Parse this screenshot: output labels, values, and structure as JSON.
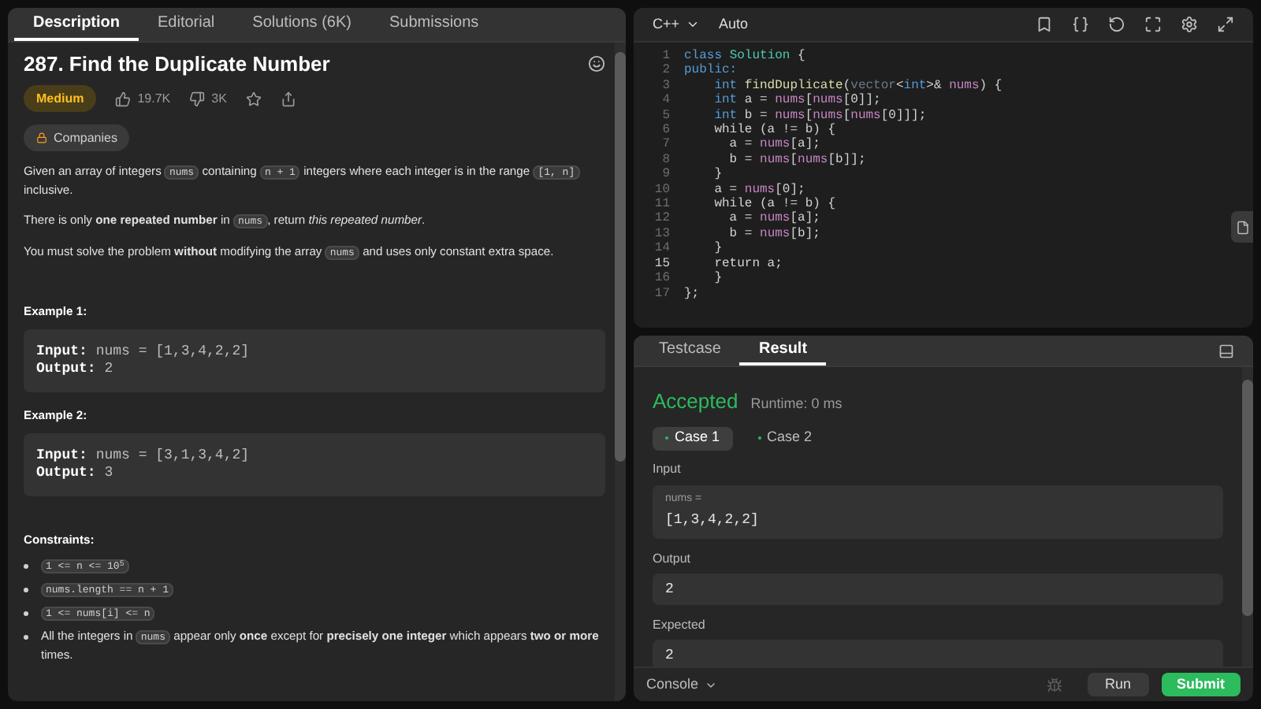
{
  "left_tabs": [
    {
      "label": "Description",
      "selected": true
    },
    {
      "label": "Editorial",
      "selected": false
    },
    {
      "label": "Solutions (6K)",
      "selected": false
    },
    {
      "label": "Submissions",
      "selected": false
    }
  ],
  "problem": {
    "title": "287. Find the Duplicate Number",
    "difficulty": "Medium",
    "likes": "19.7K",
    "dislikes": "3K",
    "companies": "Companies",
    "paragraphs": [
      [
        {
          "kind": "text",
          "text": "Given an array of integers "
        },
        {
          "kind": "code",
          "text": "nums"
        },
        {
          "kind": "text",
          "text": " containing "
        },
        {
          "kind": "code",
          "text": "n + 1"
        },
        {
          "kind": "text",
          "text": " integers where each integer is in the range "
        },
        {
          "kind": "code",
          "text": "[1, n]"
        },
        {
          "kind": "text",
          "text": " inclusive."
        }
      ],
      [
        {
          "kind": "text",
          "text": "There is only **one repeated number** in "
        },
        {
          "kind": "code",
          "text": "nums"
        },
        {
          "kind": "text",
          "text": ", return *this repeated number*."
        }
      ],
      [
        {
          "kind": "text",
          "text": "You must solve the problem **without** modifying the array "
        },
        {
          "kind": "code",
          "text": "nums"
        },
        {
          "kind": "text",
          "text": " and uses only constant extra space."
        }
      ]
    ],
    "examples": [
      {
        "title": "Example 1:",
        "input_label": "Input:",
        "input": "nums = [1,3,4,2,2]",
        "output_label": "Output:",
        "output": "2"
      },
      {
        "title": "Example 2:",
        "input_label": "Input:",
        "input": "nums = [3,1,3,4,2]",
        "output_label": "Output:",
        "output": "3"
      }
    ],
    "constraints_title": "Constraints:",
    "constraints": [
      [
        {
          "kind": "code",
          "text": "1 <= n <= 10$^{5}$"
        }
      ],
      [
        {
          "kind": "code",
          "text": "nums.length == n + 1"
        }
      ],
      [
        {
          "kind": "code",
          "text": "1 <= nums[i] <= n"
        }
      ],
      [
        {
          "kind": "text",
          "text": "All the integers in "
        },
        {
          "kind": "code",
          "text": "nums"
        },
        {
          "kind": "text",
          "text": " appear only **once** except for **precisely one integer** which appears **two or more** times."
        }
      ]
    ]
  },
  "editor": {
    "language": "C++",
    "mode": "Auto",
    "lines": [
      {
        "number": "1",
        "active": false,
        "tokens": [
          {
            "kind": "keyword",
            "text": "class "
          },
          {
            "kind": "type",
            "text": "Solution"
          },
          {
            "kind": "plain",
            "text": " {"
          }
        ]
      },
      {
        "number": "2",
        "active": false,
        "tokens": [
          {
            "kind": "keyword",
            "text": "public:"
          }
        ]
      },
      {
        "number": "3",
        "active": false,
        "tokens": [
          {
            "kind": "keyword",
            "text": "    int "
          },
          {
            "kind": "func",
            "text": "findDuplicate"
          },
          {
            "kind": "plain",
            "text": "("
          },
          {
            "kind": "dim",
            "text": "vector"
          },
          {
            "kind": "plain",
            "text": "<"
          },
          {
            "kind": "keyword",
            "text": "int"
          },
          {
            "kind": "plain",
            "text": ">& "
          },
          {
            "kind": "var",
            "text": "nums"
          },
          {
            "kind": "plain",
            "text": ") {"
          }
        ]
      },
      {
        "number": "4",
        "active": false,
        "tokens": [
          {
            "kind": "keyword",
            "text": "    int "
          },
          {
            "kind": "plain",
            "text": "a = "
          },
          {
            "kind": "var",
            "text": "nums"
          },
          {
            "kind": "plain",
            "text": "["
          },
          {
            "kind": "var",
            "text": "nums"
          },
          {
            "kind": "plain",
            "text": "[0]];"
          }
        ]
      },
      {
        "number": "5",
        "active": false,
        "tokens": [
          {
            "kind": "keyword",
            "text": "    int "
          },
          {
            "kind": "plain",
            "text": "b = "
          },
          {
            "kind": "var",
            "text": "nums"
          },
          {
            "kind": "plain",
            "text": "["
          },
          {
            "kind": "var",
            "text": "nums"
          },
          {
            "kind": "plain",
            "text": "["
          },
          {
            "kind": "var",
            "text": "nums"
          },
          {
            "kind": "plain",
            "text": "[0]]];"
          }
        ]
      },
      {
        "number": "6",
        "active": false,
        "tokens": [
          {
            "kind": "plain",
            "text": "    while (a != b) {"
          }
        ]
      },
      {
        "number": "7",
        "active": false,
        "tokens": [
          {
            "kind": "plain",
            "text": "      a = "
          },
          {
            "kind": "var",
            "text": "nums"
          },
          {
            "kind": "plain",
            "text": "[a];"
          }
        ]
      },
      {
        "number": "8",
        "active": false,
        "tokens": [
          {
            "kind": "plain",
            "text": "      b = "
          },
          {
            "kind": "var",
            "text": "nums"
          },
          {
            "kind": "plain",
            "text": "["
          },
          {
            "kind": "var",
            "text": "nums"
          },
          {
            "kind": "plain",
            "text": "[b]];"
          }
        ]
      },
      {
        "number": "9",
        "active": false,
        "tokens": [
          {
            "kind": "plain",
            "text": "    }"
          }
        ]
      },
      {
        "number": "10",
        "active": false,
        "tokens": [
          {
            "kind": "plain",
            "text": "    a = "
          },
          {
            "kind": "var",
            "text": "nums"
          },
          {
            "kind": "plain",
            "text": "[0];"
          }
        ]
      },
      {
        "number": "11",
        "active": false,
        "tokens": [
          {
            "kind": "plain",
            "text": "    while (a != b) {"
          }
        ]
      },
      {
        "number": "12",
        "active": false,
        "tokens": [
          {
            "kind": "plain",
            "text": "      a = "
          },
          {
            "kind": "var",
            "text": "nums"
          },
          {
            "kind": "plain",
            "text": "[a];"
          }
        ]
      },
      {
        "number": "13",
        "active": false,
        "tokens": [
          {
            "kind": "plain",
            "text": "      b = "
          },
          {
            "kind": "var",
            "text": "nums"
          },
          {
            "kind": "plain",
            "text": "[b];"
          }
        ]
      },
      {
        "number": "14",
        "active": false,
        "tokens": [
          {
            "kind": "plain",
            "text": "    }"
          }
        ]
      },
      {
        "number": "15",
        "active": true,
        "tokens": [
          {
            "kind": "plain",
            "text": "    return a;"
          }
        ]
      },
      {
        "number": "16",
        "active": false,
        "tokens": [
          {
            "kind": "plain",
            "text": "    }"
          }
        ]
      },
      {
        "number": "17",
        "active": false,
        "tokens": [
          {
            "kind": "plain",
            "text": "};"
          }
        ]
      }
    ]
  },
  "console_tabs": [
    {
      "label": "Testcase",
      "selected": false
    },
    {
      "label": "Result",
      "selected": true
    }
  ],
  "result": {
    "status": "Accepted",
    "runtime": "Runtime: 0 ms",
    "cases": [
      {
        "label": "Case 1",
        "selected": true
      },
      {
        "label": "Case 2",
        "selected": false
      }
    ],
    "input_label": "Input",
    "input_name": "nums =",
    "input_value": "[1,3,4,2,2]",
    "output_label": "Output",
    "output_value": "2",
    "expected_label": "Expected",
    "expected_value": "2"
  },
  "footer": {
    "console": "Console",
    "run": "Run",
    "submit": "Submit"
  }
}
